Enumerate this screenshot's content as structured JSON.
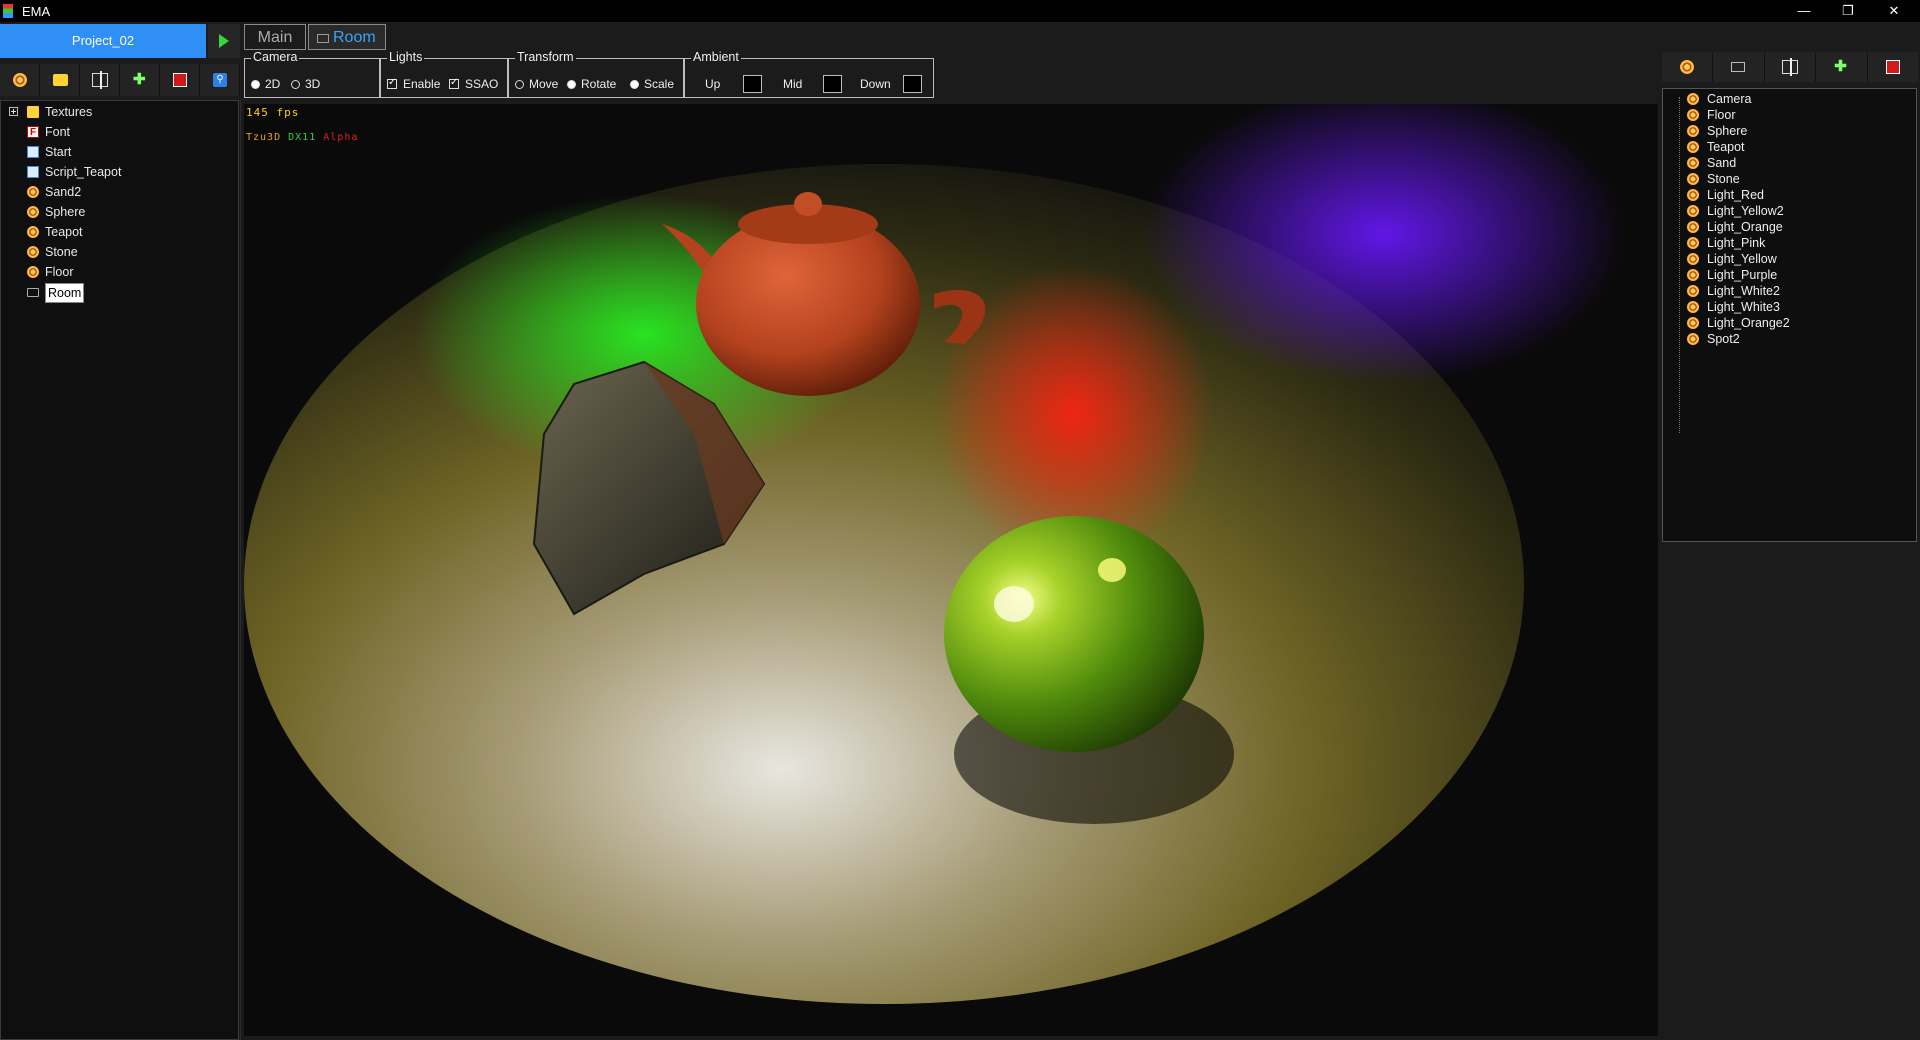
{
  "window": {
    "title": "EMA",
    "minimize": "—",
    "restore": "❐",
    "close": "✕"
  },
  "project": {
    "name": "Project_02"
  },
  "left_toolbar": [
    {
      "icon": "orb-icon"
    },
    {
      "icon": "folder-icon"
    },
    {
      "icon": "script-icon"
    },
    {
      "icon": "add-light-icon"
    },
    {
      "icon": "stop-icon"
    },
    {
      "icon": "search-icon"
    }
  ],
  "tree": [
    {
      "label": "Textures",
      "icon": "folder-icon",
      "expander": true
    },
    {
      "label": "Font",
      "icon": "font-icon"
    },
    {
      "label": "Start",
      "icon": "file-icon"
    },
    {
      "label": "Script_Teapot",
      "icon": "file-icon"
    },
    {
      "label": "Sand2",
      "icon": "orb-icon"
    },
    {
      "label": "Sphere",
      "icon": "orb-icon"
    },
    {
      "label": "Teapot",
      "icon": "orb-icon"
    },
    {
      "label": "Stone",
      "icon": "orb-icon"
    },
    {
      "label": "Floor",
      "icon": "orb-icon"
    },
    {
      "label": "Room",
      "icon": "room-icon",
      "selected": true
    }
  ],
  "tabs": {
    "main": "Main",
    "room": "Room",
    "active": "Room"
  },
  "controls": {
    "camera": {
      "label": "Camera",
      "opt_2d": "2D",
      "opt_3d": "3D",
      "selected": "2D"
    },
    "lights": {
      "label": "Lights",
      "enable": "Enable",
      "ssao": "SSAO",
      "enable_checked": true,
      "ssao_checked": true
    },
    "transform": {
      "label": "Transform",
      "move": "Move",
      "rotate": "Rotate",
      "scale": "Scale",
      "selected": "Rotate"
    },
    "ambient": {
      "label": "Ambient",
      "up": "Up",
      "mid": "Mid",
      "down": "Down",
      "up_color": "#000000",
      "mid_color": "#000000",
      "down_color": "#000000"
    }
  },
  "viewport": {
    "fps": "145 fps",
    "brand": {
      "a": "Tzu3D",
      "b": "DX11",
      "c": "Alpha"
    },
    "brand_colors": {
      "a": "#e6a020",
      "b": "#3ccf3c",
      "c": "#e02020"
    }
  },
  "right_toolbar": [
    {
      "icon": "orb-icon"
    },
    {
      "icon": "room-icon"
    },
    {
      "icon": "script-icon"
    },
    {
      "icon": "add-light-icon"
    },
    {
      "icon": "stop-icon"
    }
  ],
  "scene_objects": [
    "Camera",
    "Floor",
    "Sphere",
    "Teapot",
    "Sand",
    "Stone",
    "Light_Red",
    "Light_Yellow2",
    "Light_Orange",
    "Light_Pink",
    "Light_Yellow",
    "Light_Purple",
    "Light_White2",
    "Light_White3",
    "Light_Orange2",
    "Spot2"
  ],
  "colors": {
    "accent": "#2f8ff5",
    "play": "#37d43c",
    "tab_active": "#3aa2ff"
  }
}
